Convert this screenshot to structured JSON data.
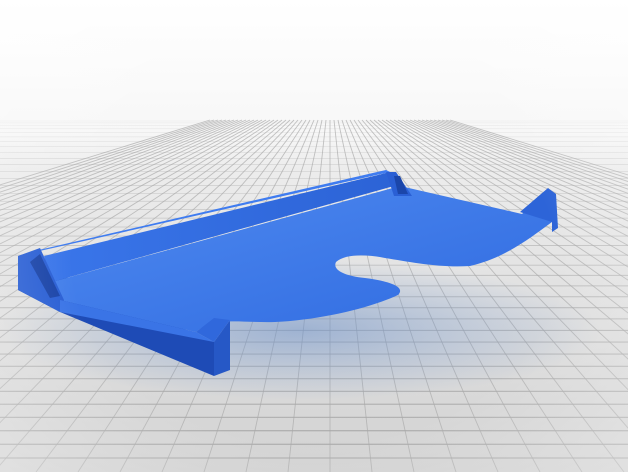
{
  "scene": {
    "background_color": "#ffffff",
    "floor_color": "#d8d8d8",
    "grid_line_color": "#a9a9a9",
    "model_color": "#2f6fe8",
    "model_shadow_color": "#8fa8c8",
    "grid_visible": true
  }
}
